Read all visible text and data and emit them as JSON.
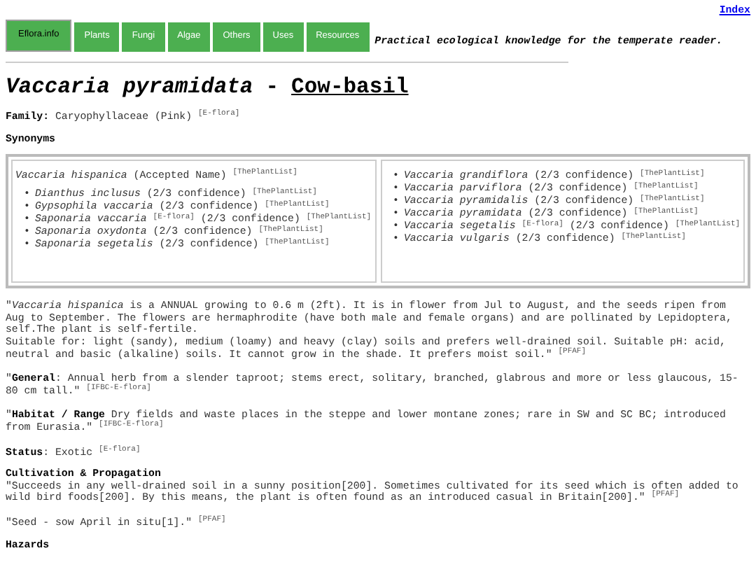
{
  "index_link": "Index",
  "tabs": [
    {
      "label": "Eflora.info",
      "selected": true
    },
    {
      "label": "Plants",
      "selected": false
    },
    {
      "label": "Fungi",
      "selected": false
    },
    {
      "label": "Algae",
      "selected": false
    },
    {
      "label": "Others",
      "selected": false
    },
    {
      "label": "Uses",
      "selected": false
    },
    {
      "label": "Resources",
      "selected": false
    }
  ],
  "tagline": "Practical ecological knowledge for the temperate reader.",
  "title": {
    "latin": "Vaccaria pyramidata",
    "separator": "-",
    "common": "Cow-basil"
  },
  "family": "**Family:** Caryophyllaceae (Pink) $^{[E-flora]}$",
  "synonyms_heading": "Synonyms",
  "synonyms": {
    "bullet": "•",
    "accepted": "*Vaccaria hispanica* (Accepted Name) $^{[ThePlantList]}$",
    "left": [
      "*Dianthus inclusus* (2/3 confidence) $^{[ThePlantList]}$",
      "*Gypsophila vaccaria* (2/3 confidence) $^{[ThePlantList]}$",
      "*Saponaria vaccaria* $^{[E-flora]}$ (2/3 confidence) $^{[ThePlantList]}$",
      "*Saponaria oxydonta* (2/3 confidence) $^{[ThePlantList]}$",
      "*Saponaria segetalis* (2/3 confidence) $^{[ThePlantList]}$"
    ],
    "right": [
      "*Vaccaria grandiflora* (2/3 confidence) $^{[ThePlantList]}$",
      "*Vaccaria parviflora* (2/3 confidence) $^{[ThePlantList]}$",
      "*Vaccaria pyramidalis* (2/3 confidence) $^{[ThePlantList]}$",
      "*Vaccaria pyramidata* (2/3 confidence) $^{[ThePlantList]}$",
      "*Vaccaria segetalis* $^{[E-flora]}$ (2/3 confidence) $^{[ThePlantList]}$",
      "*Vaccaria vulgaris* (2/3 confidence) $^{[ThePlantList]}$"
    ]
  },
  "blocks": [
    {
      "kind": "paragraph",
      "text": "\"*Vaccaria hispanica* is a ANNUAL growing to 0.6 m (2ft). It is in flower from Jul to August, and the seeds ripen from Aug to September. The flowers are hermaphrodite (have both male and female organs) and are pollinated by Lepidoptera, self.The plant is self-fertile."
    },
    {
      "kind": "continuation",
      "text": "Suitable for: light (sandy), medium (loamy) and heavy (clay) soils and prefers well-drained soil. Suitable pH: acid, neutral and basic (alkaline) soils. It cannot grow in the shade. It prefers moist soil.\" $^{[PFAF]}$"
    },
    {
      "kind": "paragraph",
      "text": "\"**General**: Annual herb from a slender taproot; stems erect, solitary, branched, glabrous and more or less glaucous, 15-80 cm tall.\" $^{[IFBC-E-flora]}$"
    },
    {
      "kind": "paragraph",
      "text": "\"**Habitat / Range** Dry fields and waste places in the steppe and lower montane zones; rare in SW and SC BC; introduced from Eurasia.\" $^{[IFBC-E-flora]}$"
    },
    {
      "kind": "paragraph",
      "text": "**Status**: Exotic $^{[E-flora]}$"
    },
    {
      "kind": "heading",
      "text": "Cultivation & Propagation"
    },
    {
      "kind": "continuation",
      "text": "\"Succeeds in any well-drained soil in a sunny position[200]. Sometimes cultivated for its seed which is often added to wild bird foods[200]. By this means, the plant is often found as an introduced casual in Britain[200].\" $^{[PFAF]}$"
    },
    {
      "kind": "paragraph",
      "text": "\"Seed - sow April in situ[1].\" $^{[PFAF]}$"
    },
    {
      "kind": "heading",
      "text": "Hazards"
    }
  ]
}
